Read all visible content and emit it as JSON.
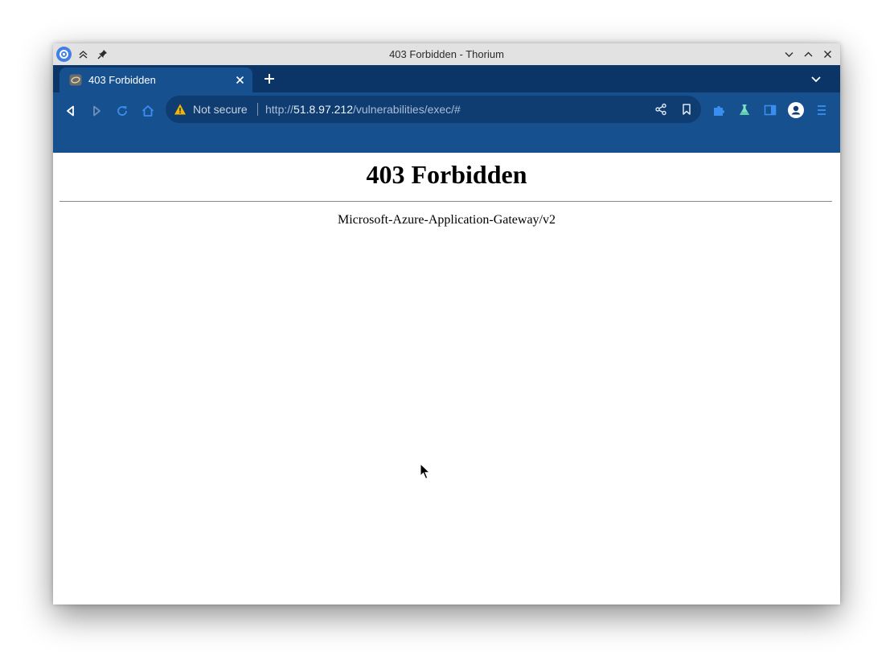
{
  "window": {
    "title": "403 Forbidden - Thorium"
  },
  "tabs": [
    {
      "title": "403 Forbidden",
      "active": true
    }
  ],
  "toolbar": {
    "security_label": "Not secure",
    "url_scheme": "http://",
    "url_host": "51.8.97.212",
    "url_path": "/vulnerabilities/exec/#"
  },
  "page": {
    "heading": "403 Forbidden",
    "server_signature": "Microsoft-Azure-Application-Gateway/v2"
  },
  "colors": {
    "tab_strip": "#0b3566",
    "toolbar": "#16508f",
    "omnibox": "#0f3d72",
    "warning": "#f4b400"
  },
  "icons": {
    "titlebar_left": [
      "thorium-logo-icon",
      "keep-above-icon",
      "pin-icon"
    ],
    "titlebar_right": [
      "minimize-icon",
      "maximize-icon",
      "close-icon"
    ],
    "nav": [
      "back-icon",
      "forward-icon",
      "reload-icon",
      "home-icon"
    ],
    "omnibox": [
      "warning-icon",
      "share-icon",
      "bookmark-icon"
    ],
    "extensions": [
      "extensions-puzzle-icon",
      "labs-flask-icon",
      "side-panel-icon",
      "profile-avatar-icon",
      "menu-icon"
    ]
  }
}
